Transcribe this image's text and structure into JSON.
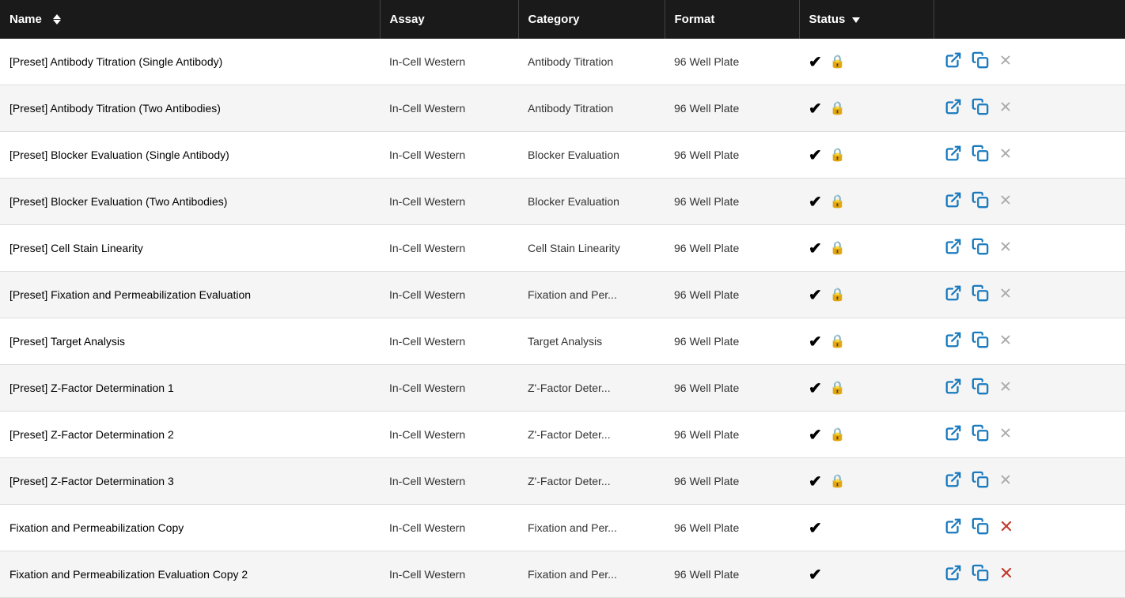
{
  "table": {
    "columns": {
      "name": "Name",
      "assay": "Assay",
      "category": "Category",
      "format": "Format",
      "status": "Status"
    },
    "rows": [
      {
        "name": "[Preset] Antibody Titration (Single Antibody)",
        "assay": "In-Cell Western",
        "category": "Antibody Titration",
        "format": "96 Well Plate",
        "hasCheck": true,
        "hasLock": true,
        "deleteIcon": "gray"
      },
      {
        "name": "[Preset] Antibody Titration (Two Antibodies)",
        "assay": "In-Cell Western",
        "category": "Antibody Titration",
        "format": "96 Well Plate",
        "hasCheck": true,
        "hasLock": true,
        "deleteIcon": "gray"
      },
      {
        "name": "[Preset] Blocker Evaluation (Single Antibody)",
        "assay": "In-Cell Western",
        "category": "Blocker Evaluation",
        "format": "96 Well Plate",
        "hasCheck": true,
        "hasLock": true,
        "deleteIcon": "gray"
      },
      {
        "name": "[Preset] Blocker Evaluation (Two Antibodies)",
        "assay": "In-Cell Western",
        "category": "Blocker Evaluation",
        "format": "96 Well Plate",
        "hasCheck": true,
        "hasLock": true,
        "deleteIcon": "gray"
      },
      {
        "name": "[Preset] Cell Stain Linearity",
        "assay": "In-Cell Western",
        "category": "Cell Stain Linearity",
        "format": "96 Well Plate",
        "hasCheck": true,
        "hasLock": true,
        "deleteIcon": "gray"
      },
      {
        "name": "[Preset] Fixation and Permeabilization Evaluation",
        "assay": "In-Cell Western",
        "category": "Fixation and Per...",
        "format": "96 Well Plate",
        "hasCheck": true,
        "hasLock": true,
        "deleteIcon": "gray"
      },
      {
        "name": "[Preset] Target Analysis",
        "assay": "In-Cell Western",
        "category": "Target Analysis",
        "format": "96 Well Plate",
        "hasCheck": true,
        "hasLock": true,
        "deleteIcon": "gray"
      },
      {
        "name": "[Preset] Z-Factor Determination 1",
        "assay": "In-Cell Western",
        "category": "Z'-Factor Deter...",
        "format": "96 Well Plate",
        "hasCheck": true,
        "hasLock": true,
        "deleteIcon": "gray"
      },
      {
        "name": "[Preset] Z-Factor Determination 2",
        "assay": "In-Cell Western",
        "category": "Z'-Factor Deter...",
        "format": "96 Well Plate",
        "hasCheck": true,
        "hasLock": true,
        "deleteIcon": "gray"
      },
      {
        "name": "[Preset] Z-Factor Determination 3",
        "assay": "In-Cell Western",
        "category": "Z'-Factor Deter...",
        "format": "96 Well Plate",
        "hasCheck": true,
        "hasLock": true,
        "deleteIcon": "gray"
      },
      {
        "name": "Fixation and Permeabilization Copy",
        "assay": "In-Cell Western",
        "category": "Fixation and Per...",
        "format": "96 Well Plate",
        "hasCheck": true,
        "hasLock": false,
        "deleteIcon": "red"
      },
      {
        "name": "Fixation and Permeabilization Evaluation Copy 2",
        "assay": "In-Cell Western",
        "category": "Fixation and Per...",
        "format": "96 Well Plate",
        "hasCheck": true,
        "hasLock": false,
        "deleteIcon": "red"
      }
    ]
  }
}
